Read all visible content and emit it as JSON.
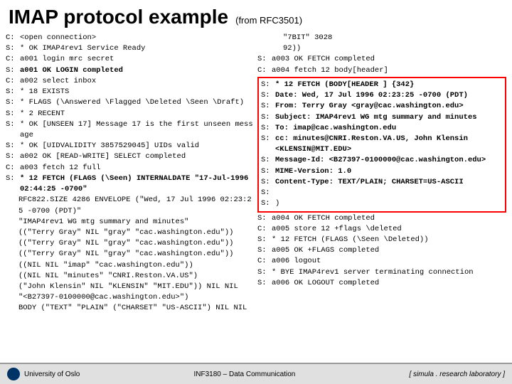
{
  "header": {
    "title": "IMAP protocol example",
    "subtitle": "(from RFC3501)"
  },
  "left_column": {
    "lines": [
      {
        "prefix": "C:",
        "text": "<open connection>",
        "style": "normal"
      },
      {
        "prefix": "S:",
        "text": "* OK IMAP4rev1 Service Ready",
        "style": "normal"
      },
      {
        "prefix": "C:",
        "text": "a001 login mrc secret",
        "style": "normal"
      },
      {
        "prefix": "S:",
        "text": "a001 OK LOGIN completed",
        "style": "bold"
      },
      {
        "prefix": "C:",
        "text": "a002 select inbox",
        "style": "normal"
      },
      {
        "prefix": "S:",
        "text": "* 18 EXISTS",
        "style": "normal"
      },
      {
        "prefix": "S:",
        "text": "* FLAGS (\\Answered \\Flagged \\Deleted \\Seen \\Draft)",
        "style": "normal"
      },
      {
        "prefix": "S:",
        "text": "* 2 RECENT",
        "style": "normal"
      },
      {
        "prefix": "S:",
        "text": "* OK [UNSEEN 17] Message 17 is the first unseen message",
        "style": "normal"
      },
      {
        "prefix": "S:",
        "text": "* OK [UIDVALIDITY 3857529045] UIDs valid",
        "style": "normal"
      },
      {
        "prefix": "S:",
        "text": "a002 OK [READ-WRITE] SELECT completed",
        "style": "normal"
      },
      {
        "prefix": "C:",
        "text": "a003 fetch 12 full",
        "style": "normal"
      },
      {
        "prefix": "S:",
        "text": "* 12 FETCH (FLAGS (\\Seen) INTERNALDATE \"17-Jul-1996 02:44:25 -0700\"",
        "style": "bold-start"
      },
      {
        "prefix": "",
        "text": "RFC822.SIZE 4286 ENVELOPE (\"Wed, 17 Jul 1996 02:23:25 -0700 (PDT)\"",
        "style": "normal",
        "indent": true
      },
      {
        "prefix": "",
        "text": "\"IMAP4rev1 WG mtg summary and minutes\"",
        "style": "normal",
        "indent": true
      },
      {
        "prefix": "",
        "text": "((\"Terry Gray\" NIL \"gray\" \"cac.washington.edu\"))",
        "style": "normal",
        "indent": true
      },
      {
        "prefix": "",
        "text": "((\"Terry Gray\" NIL \"gray\" \"cac.washington.edu\"))",
        "style": "normal",
        "indent": true
      },
      {
        "prefix": "",
        "text": "((\"Terry Gray\" NIL \"gray\" \"cac.washington.edu\"))",
        "style": "normal",
        "indent": true
      },
      {
        "prefix": "",
        "text": "((NIL NIL \"imap\" \"cac.washington.edu\"))",
        "style": "normal",
        "indent": true
      },
      {
        "prefix": "",
        "text": "((NIL NIL \"minutes\" \"CNRI.Reston.VA.US\")",
        "style": "normal",
        "indent": true
      },
      {
        "prefix": "",
        "text": "(\"John Klensin\" NIL \"KLENSIN\" \"MIT.EDU\")) NIL NIL",
        "style": "normal",
        "indent": true
      },
      {
        "prefix": "",
        "text": "\"<B27397-0100000@cac.washington.edu>\")",
        "style": "normal",
        "indent": true
      },
      {
        "prefix": "",
        "text": "BODY (\"TEXT\" \"PLAIN\" (\"CHARSET\" \"US-ASCII\") NIL NIL",
        "style": "normal",
        "indent": true
      }
    ]
  },
  "right_column": {
    "top_text": "\"7BIT\" 3028",
    "top_text2": "92))",
    "lines": [
      {
        "prefix": "S:",
        "text": "a003 OK FETCH completed",
        "style": "normal"
      },
      {
        "prefix": "C:",
        "text": "a004 fetch 12 body[header]",
        "style": "normal"
      },
      {
        "prefix": "S:",
        "text": "* 12 FETCH (BODY[HEADER ] {342}",
        "style": "bold"
      },
      {
        "prefix": "S:",
        "text": "Date: Wed, 17 Jul 1996 02:23:25 -0700 (PDT)",
        "style": "bold"
      },
      {
        "prefix": "S:",
        "text": "From: Terry Gray <gray@cac.washington.edu>",
        "style": "bold"
      },
      {
        "prefix": "S:",
        "text": "Subject: IMAP4rev1 WG mtg summary and minutes",
        "style": "bold"
      },
      {
        "prefix": "S:",
        "text": "To: imap@cac.washington.edu",
        "style": "bold"
      },
      {
        "prefix": "S:",
        "text": "cc: minutes@CNRI.Reston.VA.US, John Klensin <KLENSIN@MIT.EDU>",
        "style": "bold"
      },
      {
        "prefix": "S:",
        "text": "Message-Id: <B27397-0100000@cac.washington.edu>",
        "style": "bold"
      },
      {
        "prefix": "S:",
        "text": "MIME-Version: 1.0",
        "style": "bold"
      },
      {
        "prefix": "S:",
        "text": "Content-Type: TEXT/PLAIN; CHARSET=US-ASCII",
        "style": "bold"
      },
      {
        "prefix": "S:",
        "text": "",
        "style": "normal"
      },
      {
        "prefix": "S:",
        "text": ")",
        "style": "normal"
      },
      {
        "prefix": "S:",
        "text": "a004 OK FETCH completed",
        "style": "normal"
      },
      {
        "prefix": "C:",
        "text": "a005 store 12 +flags \\deleted",
        "style": "normal"
      },
      {
        "prefix": "S:",
        "text": "* 12 FETCH (FLAGS (\\Seen \\Deleted))",
        "style": "normal"
      },
      {
        "prefix": "S:",
        "text": "a005 OK +FLAGS completed",
        "style": "normal"
      },
      {
        "prefix": "C:",
        "text": "a006 logout",
        "style": "normal"
      },
      {
        "prefix": "S:",
        "text": "* BYE IMAP4rev1 server terminating connection",
        "style": "normal"
      },
      {
        "prefix": "S:",
        "text": "a006 OK LOGOUT completed",
        "style": "normal"
      }
    ]
  },
  "footer": {
    "university": "University of Oslo",
    "course": "INF3180 – Data Communication",
    "lab": "[ simula . research laboratory ]"
  }
}
